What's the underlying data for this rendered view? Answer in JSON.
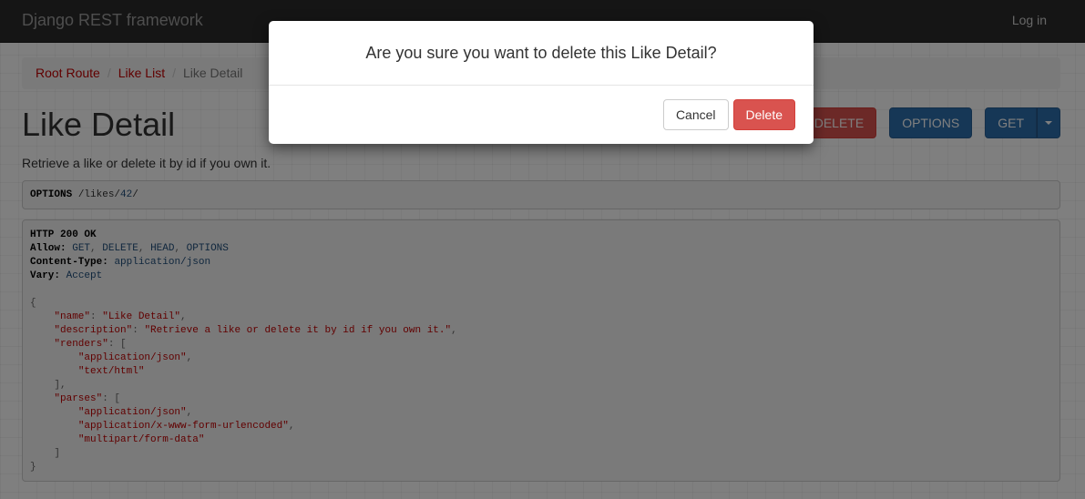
{
  "navbar": {
    "brand": "Django REST framework",
    "login": "Log in"
  },
  "breadcrumb": [
    {
      "label": "Root Route"
    },
    {
      "label": "Like List"
    },
    {
      "label": "Like Detail"
    }
  ],
  "breadcrumb_separator": "/",
  "title": "Like Detail",
  "description": "Retrieve a like or delete it by id if you own it.",
  "buttons": {
    "delete": "DELETE",
    "options": "OPTIONS",
    "get": "GET"
  },
  "request": {
    "method": "OPTIONS",
    "path_prefix": "/likes/",
    "id": "42",
    "path_suffix": "/"
  },
  "response": {
    "status": "HTTP 200 OK",
    "headers": [
      {
        "name": "Allow",
        "values": [
          "GET",
          "DELETE",
          "HEAD",
          "OPTIONS"
        ]
      },
      {
        "name": "Content-Type",
        "values": [
          "application/json"
        ]
      },
      {
        "name": "Vary",
        "values": [
          "Accept"
        ]
      }
    ],
    "body": {
      "name_key": "\"name\"",
      "name_val": "\"Like Detail\"",
      "description_key": "\"description\"",
      "description_val": "\"Retrieve a like or delete it by id if you own it.\"",
      "renders_key": "\"renders\"",
      "renders": [
        "\"application/json\"",
        "\"text/html\""
      ],
      "parses_key": "\"parses\"",
      "parses": [
        "\"application/json\"",
        "\"application/x-www-form-urlencoded\"",
        "\"multipart/form-data\""
      ]
    }
  },
  "modal": {
    "title": "Are you sure you want to delete this Like Detail?",
    "cancel": "Cancel",
    "delete": "Delete"
  },
  "icons": {
    "dropdown": "caret-down-icon"
  },
  "colors": {
    "navbar": "#2b2b2b",
    "danger": "#d9534f",
    "primary": "#2c6fad",
    "link": "#c20000"
  }
}
